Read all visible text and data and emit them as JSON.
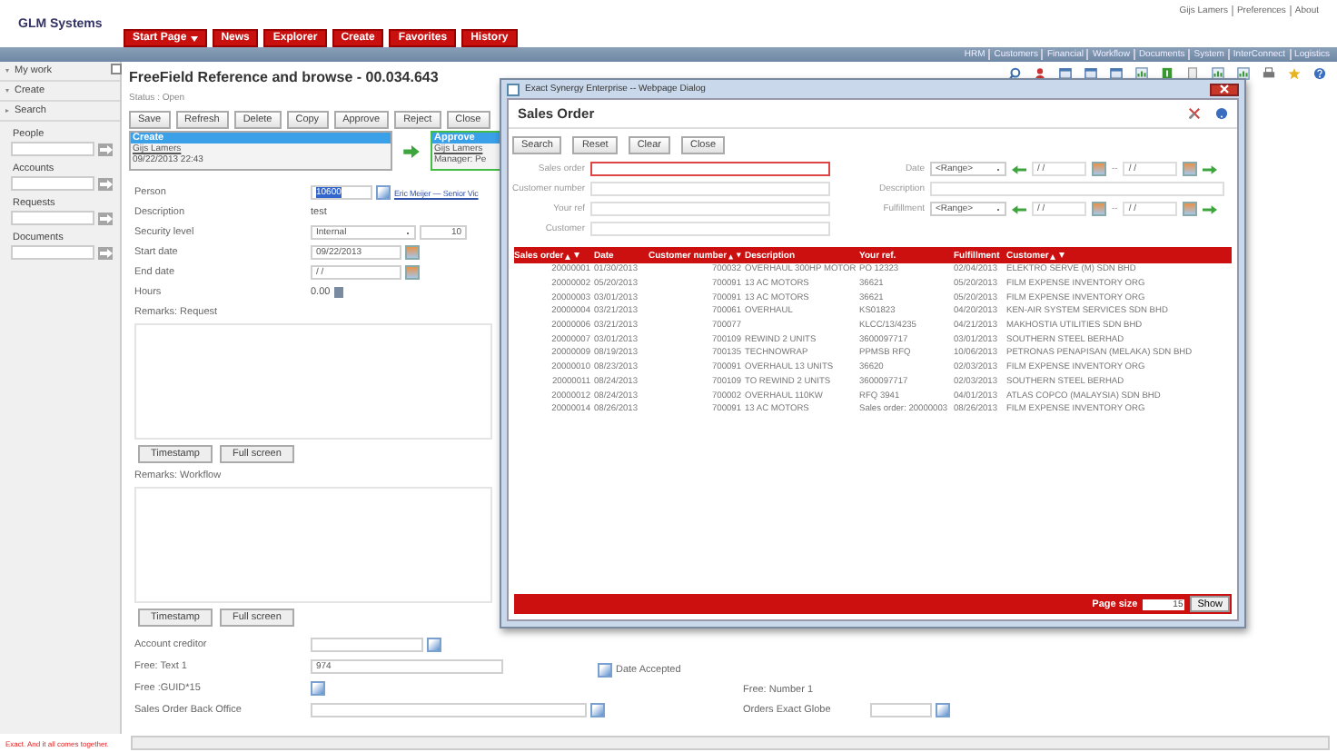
{
  "header": {
    "logo": "GLM Systems",
    "menu": [
      {
        "label": "Start Page",
        "dropdown": true
      },
      {
        "label": "News",
        "dropdown": false
      },
      {
        "label": "Explorer",
        "dropdown": false
      },
      {
        "label": "Create",
        "dropdown": false
      },
      {
        "label": "Favorites",
        "dropdown": false
      },
      {
        "label": "History",
        "dropdown": false
      }
    ],
    "user_links": [
      "Gijs Lamers",
      "Preferences",
      "About"
    ],
    "modules": [
      "HRM",
      "Customers",
      "Financial",
      "Workflow",
      "Documents",
      "System",
      "InterConnect",
      "Logistics"
    ]
  },
  "sidebar": {
    "sections": [
      {
        "label": "My work",
        "expanded": true
      },
      {
        "label": "Create",
        "expanded": true
      },
      {
        "label": "Search",
        "expanded": false
      }
    ],
    "search_fields": [
      "People",
      "Accounts",
      "Requests",
      "Documents"
    ]
  },
  "page": {
    "title": "FreeField Reference and browse - 00.034.643",
    "status": "Status : Open",
    "buttons": [
      "Save",
      "Refresh",
      "Delete",
      "Copy",
      "Approve",
      "Reject",
      "Close"
    ],
    "workflow": [
      {
        "header": "Create",
        "lines": [
          "Gijs Lamers",
          "09/22/2013 22:43"
        ]
      },
      {
        "header": "Approve",
        "lines": [
          "Gijs Lamers",
          "Manager: Pe"
        ]
      }
    ],
    "fields": [
      {
        "kind": "person",
        "label": "Person",
        "value": "10600",
        "link": "Eric Meijer — Senior Vic"
      },
      {
        "kind": "plain",
        "label": "Description",
        "value": "test"
      },
      {
        "kind": "select",
        "label": "Security level",
        "value": "Internal",
        "extra": "10"
      },
      {
        "kind": "date",
        "label": "Start date",
        "value": "09/22/2013"
      },
      {
        "kind": "date",
        "label": "End date",
        "value": "/ /"
      },
      {
        "kind": "hours",
        "label": "Hours",
        "value": "0.00"
      }
    ],
    "remarks": [
      {
        "label": "Remarks: Request",
        "buttons": [
          "Timestamp",
          "Full screen"
        ]
      },
      {
        "label": "Remarks: Workflow",
        "buttons": [
          "Timestamp",
          "Full screen"
        ]
      }
    ],
    "extra_fields": [
      {
        "label": "Account creditor",
        "kind": "lookup"
      },
      {
        "label": "Free: Text 1",
        "kind": "text",
        "value": "974"
      },
      {
        "label": "Free :GUID*15",
        "kind": "icon"
      },
      {
        "label": "Sales Order Back Office",
        "kind": "wide"
      }
    ],
    "right_fields": [
      "Date Accepted",
      "Free: Number 1",
      "Orders Exact Globe"
    ]
  },
  "dialog": {
    "title": "Exact Synergy Enterprise -- Webpage Dialog",
    "heading": "Sales Order",
    "buttons": [
      "Search",
      "Reset",
      "Clear",
      "Close"
    ],
    "left_filters": [
      {
        "label": "Sales order",
        "focused": true
      },
      {
        "label": "Customer number",
        "focused": false
      },
      {
        "label": "Your ref",
        "focused": false
      },
      {
        "label": "Customer",
        "focused": false
      }
    ],
    "right_filters": [
      {
        "kind": "range",
        "label": "Date",
        "select": "<Range>",
        "from": "/ /",
        "separator": "--",
        "to": "/ /"
      },
      {
        "kind": "text",
        "label": "Description"
      },
      {
        "kind": "range",
        "label": "Fulfillment",
        "select": "<Range>",
        "from": "/ /",
        "separator": "--",
        "to": "/ /"
      }
    ],
    "columns": [
      {
        "label": "Sales order",
        "sortable": true
      },
      {
        "label": "Date",
        "sortable": false
      },
      {
        "label": "Customer number",
        "sortable": true
      },
      {
        "label": "Description",
        "sortable": false
      },
      {
        "label": "Your ref.",
        "sortable": false
      },
      {
        "label": "Fulfillment",
        "sortable": false
      },
      {
        "label": "Customer",
        "sortable": true
      }
    ],
    "rows": [
      [
        "20000001",
        "01/30/2013",
        "700032",
        "OVERHAUL 300HP MOTOR",
        "PO 12323",
        "02/04/2013",
        "ELEKTRO SERVE (M) SDN BHD"
      ],
      [
        "20000002",
        "05/20/2013",
        "700091",
        "13 AC MOTORS",
        "36621",
        "05/20/2013",
        "FILM EXPENSE INVENTORY ORG"
      ],
      [
        "20000003",
        "03/01/2013",
        "700091",
        "13 AC MOTORS",
        "36621",
        "05/20/2013",
        "FILM EXPENSE INVENTORY ORG"
      ],
      [
        "20000004",
        "03/21/2013",
        "700061",
        "OVERHAUL",
        "KS01823",
        "04/20/2013",
        "KEN-AIR SYSTEM SERVICES SDN BHD"
      ],
      [
        "20000006",
        "03/21/2013",
        "700077",
        "",
        "KLCC/13/4235",
        "04/21/2013",
        "MAKHOSTIA UTILITIES SDN BHD"
      ],
      [
        "20000007",
        "03/01/2013",
        "700109",
        "REWIND 2 UNITS",
        "3600097717",
        "03/01/2013",
        "SOUTHERN STEEL BERHAD"
      ],
      [
        "20000009",
        "08/19/2013",
        "700135",
        "TECHNOWRAP",
        "PPMSB RFQ",
        "10/06/2013",
        "PETRONAS PENAPISAN (MELAKA) SDN BHD"
      ],
      [
        "20000010",
        "08/23/2013",
        "700091",
        "OVERHAUL 13 UNITS",
        "36620",
        "02/03/2013",
        "FILM EXPENSE INVENTORY ORG"
      ],
      [
        "20000011",
        "08/24/2013",
        "700109",
        "TO REWIND 2 UNITS",
        "3600097717",
        "02/03/2013",
        "SOUTHERN STEEL BERHAD"
      ],
      [
        "20000012",
        "08/24/2013",
        "700002",
        "OVERHAUL 110KW",
        "RFQ 3941",
        "04/01/2013",
        "ATLAS COPCO (MALAYSIA) SDN BHD"
      ],
      [
        "20000014",
        "08/26/2013",
        "700091",
        "13 AC MOTORS",
        "Sales order: 20000003",
        "08/26/2013",
        "FILM EXPENSE INVENTORY ORG"
      ]
    ],
    "page_size_label": "Page size",
    "page_size": "15",
    "show": "Show"
  },
  "footer": {
    "slogan": "Exact. And it all comes together."
  }
}
